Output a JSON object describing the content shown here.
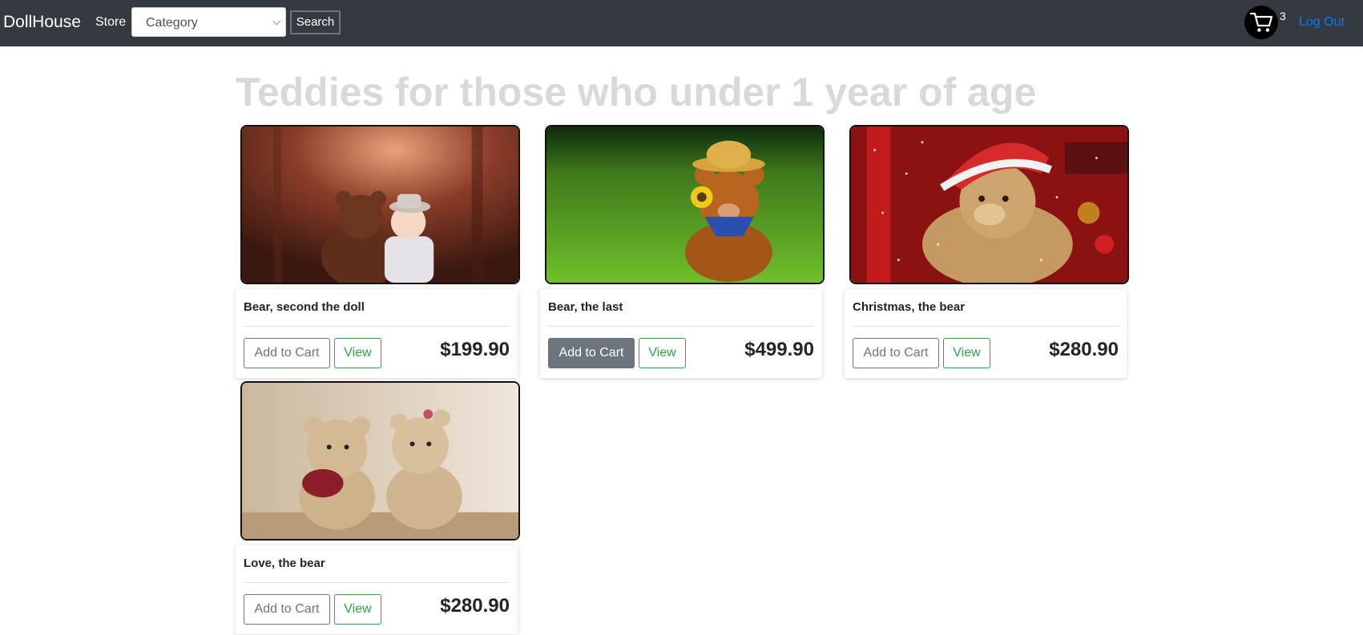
{
  "navbar": {
    "brand": "DollHouse",
    "store_label": "Store",
    "category_value": "Category",
    "search_label": "Search",
    "cart_count": "3",
    "logout_label": "Log Out"
  },
  "page": {
    "title": "Teddies for those who under 1 year of age"
  },
  "products": [
    {
      "name": "Bear, second the doll",
      "add_label": "Add to Cart",
      "view_label": "View",
      "price": "$199.90",
      "image": "teddy-with-child-image"
    },
    {
      "name": "Bear, the last",
      "add_label": "Add to Cart",
      "view_label": "View",
      "price": "$499.90",
      "image": "teddy-in-grass-image"
    },
    {
      "name": "Christmas, the bear",
      "add_label": "Add to Cart",
      "view_label": "View",
      "price": "$280.90",
      "image": "christmas-teddy-image"
    },
    {
      "name": "Love, the bear",
      "add_label": "Add to Cart",
      "view_label": "View",
      "price": "$280.90",
      "image": "teddy-couple-image"
    }
  ],
  "colors": {
    "navbar": "#343a40",
    "link": "#007bff",
    "view": "#28a745",
    "secondary": "#6c757d"
  }
}
